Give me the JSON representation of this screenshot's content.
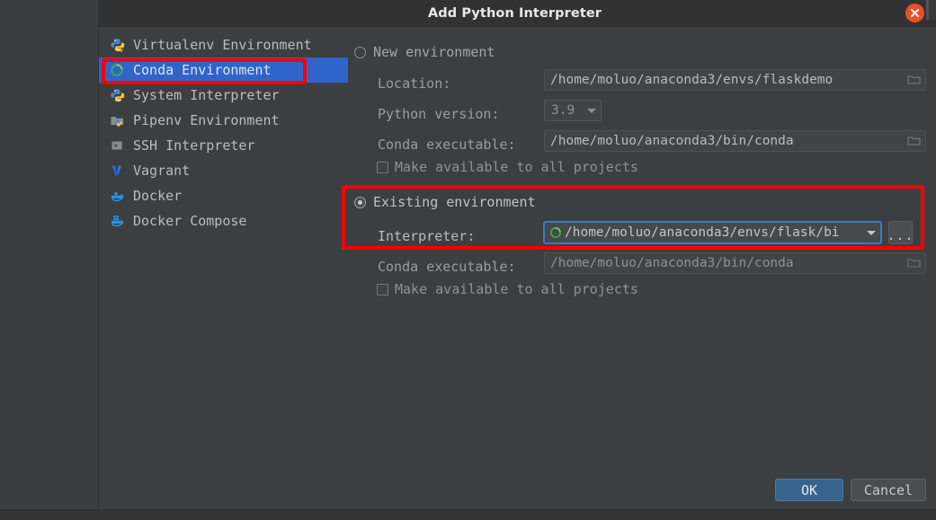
{
  "window": {
    "title": "Add Python Interpreter",
    "close_icon": "close-icon"
  },
  "sidebar": {
    "items": [
      {
        "label": "Virtualenv Environment",
        "icon": "python-virtualenv-icon",
        "selected": false
      },
      {
        "label": "Conda Environment",
        "icon": "conda-icon",
        "selected": true
      },
      {
        "label": "System Interpreter",
        "icon": "python-icon",
        "selected": false
      },
      {
        "label": "Pipenv Environment",
        "icon": "pipenv-icon",
        "selected": false
      },
      {
        "label": "SSH Interpreter",
        "icon": "terminal-icon",
        "selected": false
      },
      {
        "label": "Vagrant",
        "icon": "vagrant-icon",
        "selected": false
      },
      {
        "label": "Docker",
        "icon": "docker-icon",
        "selected": false
      },
      {
        "label": "Docker Compose",
        "icon": "docker-compose-icon",
        "selected": false
      }
    ]
  },
  "new_environment": {
    "radio_label": "New environment",
    "selected": false,
    "location_label": "Location:",
    "location_value": "/home/moluo/anaconda3/envs/flaskdemo",
    "python_version_label": "Python version:",
    "python_version_value": "3.9",
    "conda_executable_label": "Conda executable:",
    "conda_executable_value": "/home/moluo/anaconda3/bin/conda",
    "make_available_label": "Make available to all projects",
    "make_available_checked": false
  },
  "existing_environment": {
    "radio_label": "Existing environment",
    "selected": true,
    "interpreter_label": "Interpreter:",
    "interpreter_value": "/home/moluo/anaconda3/envs/flask/bi",
    "browse_label": "...",
    "conda_executable_label": "Conda executable:",
    "conda_executable_value": "/home/moluo/anaconda3/bin/conda",
    "make_available_label": "Make available to all projects",
    "make_available_checked": false
  },
  "footer": {
    "ok_label": "OK",
    "cancel_label": "Cancel"
  },
  "annotations": {
    "highlight_color": "#fb0000",
    "accent_selection": "#2f65ca",
    "ok_button_color": "#37648f"
  }
}
